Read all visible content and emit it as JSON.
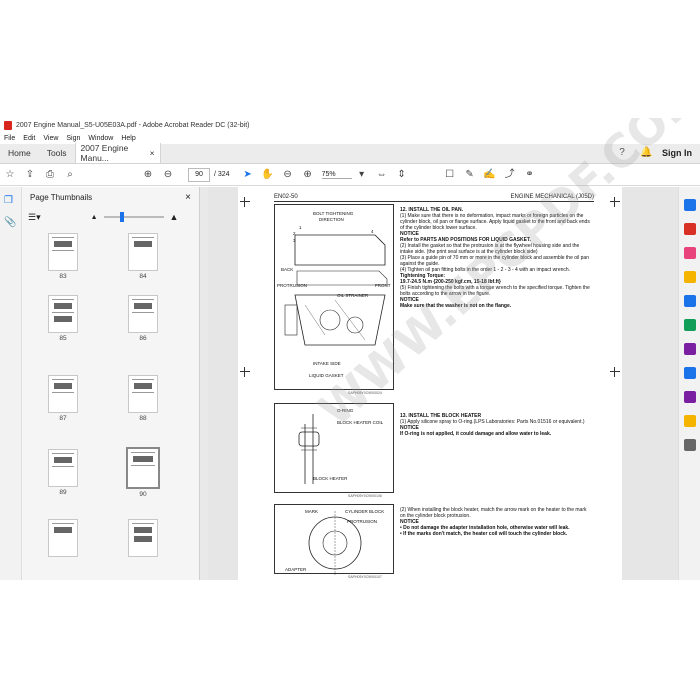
{
  "window": {
    "title": "2007 Engine Manual_S5-U05E03A.pdf - Adobe Acrobat Reader DC (32-bit)"
  },
  "menu": [
    "File",
    "Edit",
    "View",
    "Sign",
    "Window",
    "Help"
  ],
  "tabs": {
    "home": "Home",
    "tools": "Tools",
    "doc": "2007 Engine Manu...",
    "close": "×"
  },
  "signin": "Sign In",
  "toolbar": {
    "page_current": "90",
    "page_total": "/ 324",
    "zoom": "75%"
  },
  "thumbnails": {
    "title": "Page Thumbnails",
    "close": "×",
    "pages": [
      "83",
      "84",
      "85",
      "86",
      "87",
      "88",
      "89",
      "90"
    ]
  },
  "page": {
    "header_left": "EN02-50",
    "header_right": "ENGINE MECHANICAL (J05D)",
    "fig1": {
      "labels": [
        "BOLT TIGHTENING",
        "DIRECTION",
        "BACK",
        "PROTRUSION",
        "FRONT",
        "OIL STRAINER",
        "INTAKE SIDE",
        "LIQUID GASKET",
        "1",
        "2",
        "3",
        "4"
      ],
      "code": "SAPH05Y0C9000024"
    },
    "fig2": {
      "labels": [
        "O-RING",
        "BLOCK HEATER COIL",
        "BLOCK HEATER"
      ],
      "code": "SAPH05Y0C9000106"
    },
    "fig3": {
      "labels": [
        "MARK",
        "CYLINDER BLOCK",
        "PROTRUSION",
        "ADAPTER"
      ],
      "code": "SAPH05Y0C9000107"
    },
    "s12": {
      "title": "12.   INSTALL THE OIL PAN.",
      "p1": "(1)   Make sure that there is no deformation, impact marks or foreign particles on the cylinder block, oil pan or flange surface. Apply liquid gasket to the front and back ends of the cylinder block lower surface.",
      "notice": "NOTICE",
      "refer": "Refer to PARTS AND POSITIONS FOR LIQUID GASKET.",
      "p2": "(2)   Install the gasket so that the protrusion is at the flywheel housing side and the intake side. (the print seal surface is at the cylinder block side)",
      "p3": "(3)   Place a guide pin of 70 mm or more in the cylinder block and assemble the oil pan against the guide.",
      "p4": "(4)   Tighten oil pan fitting bolts in the order 1 - 2 - 3 - 4 with an impact wrench.",
      "torque_label": "Tightening Torque:",
      "torque": "19.7-24.5 N.m {200-250 kgf.cm, 15-18 lbf.ft}",
      "p5": "(5)   Finish tightening the bolts with a torque wrench to the specified torque. Tighten the bolts according to the arrow in the figure.",
      "notice2": "NOTICE",
      "washer": "Make sure that the washer is not on the flange."
    },
    "s13": {
      "title": "13.   INSTALL THE BLOCK HEATER",
      "p1": "(1)   Apply silicone spray to O-ring.(LPS Laboratories: Parts No.01516 or equivalent.)",
      "notice": "NOTICE",
      "warn": "If O-ring is not applied, it could damage and allow water to leak.",
      "p2": "(2)   When installing the block heater, match the arrow mark on the heater to the mark on the cylinder block protrusion.",
      "notice2": "NOTICE",
      "b1": "•   Do not damage the adapter installation hole, otherwise water will leak.",
      "b2": "•   If the marks don't match, the heater coil will touch the cylinder block."
    }
  },
  "watermark": "WWW.EPCPDF.COM"
}
